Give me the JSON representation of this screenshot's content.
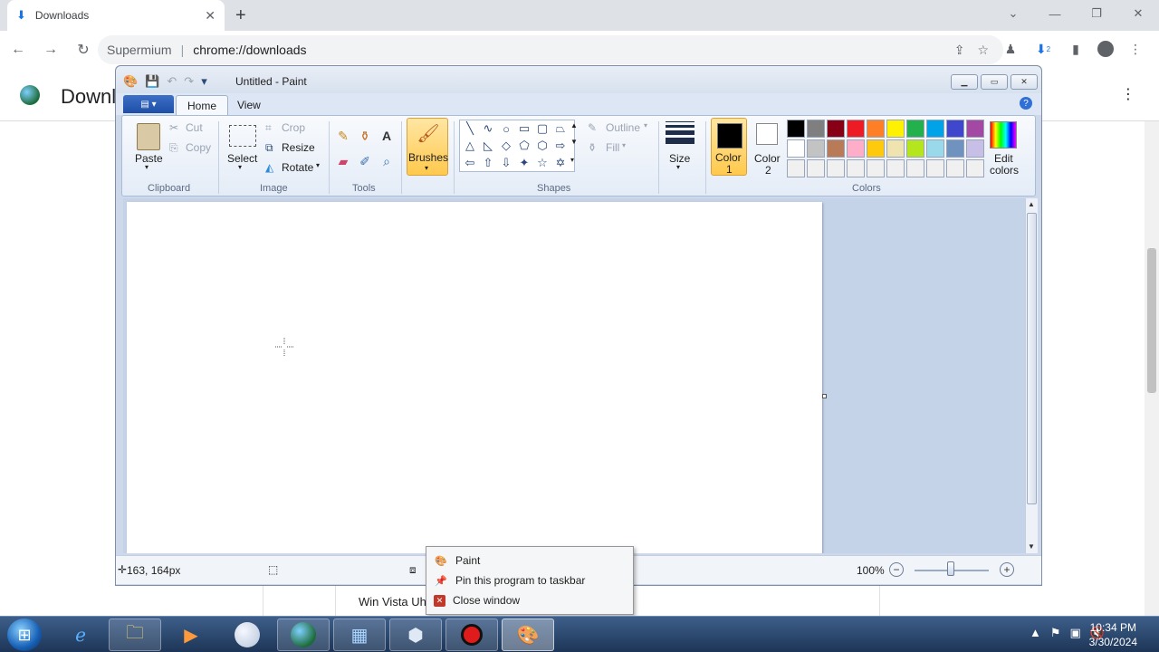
{
  "browser": {
    "tab_title": "Downloads",
    "tab_close": "✕",
    "new_tab": "+",
    "site_name": "Supermium",
    "url": "chrome://downloads",
    "download_badge": "2",
    "page_title": "Downloads",
    "download_item_name": "Win Vista Uh"
  },
  "paint": {
    "title": "Untitled - Paint",
    "tabs": {
      "home": "Home",
      "view": "View"
    },
    "clipboard": {
      "paste": "Paste",
      "cut": "Cut",
      "copy": "Copy",
      "group": "Clipboard"
    },
    "image": {
      "select": "Select",
      "crop": "Crop",
      "resize": "Resize",
      "rotate": "Rotate",
      "group": "Image"
    },
    "tools": {
      "group": "Tools"
    },
    "brushes": {
      "label": "Brushes"
    },
    "shapes": {
      "outline": "Outline",
      "fill": "Fill",
      "group": "Shapes"
    },
    "size": {
      "label": "Size"
    },
    "colors": {
      "color1_line1": "Color",
      "color1_line2": "1",
      "color2_line1": "Color",
      "color2_line2": "2",
      "edit_line1": "Edit",
      "edit_line2": "colors",
      "group": "Colors",
      "color1": "#000000",
      "color2": "#ffffff",
      "palette": [
        "#000000",
        "#7f7f7f",
        "#880015",
        "#ed1c24",
        "#ff7f27",
        "#fff200",
        "#22b14c",
        "#00a2e8",
        "#3f48cc",
        "#a349a4",
        "#ffffff",
        "#c3c3c3",
        "#b97a57",
        "#ffaec9",
        "#ffc90e",
        "#efe4b0",
        "#b5e61d",
        "#99d9ea",
        "#7092be",
        "#c8bfe7",
        "#f0f0f0",
        "#f0f0f0",
        "#f0f0f0",
        "#f0f0f0",
        "#f0f0f0",
        "#f0f0f0",
        "#f0f0f0",
        "#f0f0f0",
        "#f0f0f0",
        "#f0f0f0"
      ]
    },
    "status": {
      "position": "163, 164px",
      "zoom": "100%"
    }
  },
  "context_menu": {
    "items": [
      "Paint",
      "Pin this program to taskbar",
      "Close window"
    ]
  },
  "taskbar": {
    "time": "10:34 PM",
    "date": "3/30/2024"
  }
}
